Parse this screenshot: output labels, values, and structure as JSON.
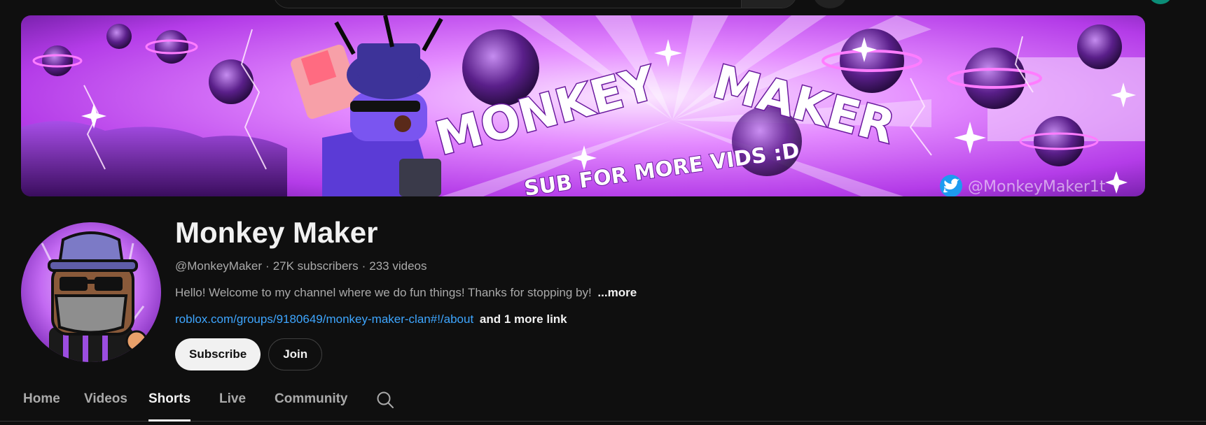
{
  "channel": {
    "name": "Monkey Maker",
    "handle": "@MonkeyMaker",
    "subscribers": "27K subscribers",
    "videos": "233 videos",
    "separator": "·",
    "description": "Hello! Welcome to my channel where we do fun things! Thanks for stopping by!",
    "more_label": "...more",
    "link_text": "roblox.com/groups/9180649/monkey-maker-clan#!/about",
    "more_links": "and 1 more link"
  },
  "banner": {
    "title_left": "MONKEY",
    "title_right": "MAKER",
    "tagline": "SUB FOR MORE VIDS :D",
    "twitter_handle": "@MonkeyMaker1t"
  },
  "actions": {
    "subscribe": "Subscribe",
    "join": "Join"
  },
  "tabs": [
    {
      "label": "Home",
      "active": false
    },
    {
      "label": "Videos",
      "active": false
    },
    {
      "label": "Shorts",
      "active": true
    },
    {
      "label": "Live",
      "active": false
    },
    {
      "label": "Community",
      "active": false
    }
  ],
  "icons": {
    "tab_search": "search-icon",
    "twitter": "twitter-icon"
  },
  "colors": {
    "background": "#0f0f0f",
    "link": "#3ea6ff",
    "banner_primary": "#d24dff",
    "avatar_bg": "#b04ef0",
    "twitter_blue": "#1d9bf0"
  }
}
